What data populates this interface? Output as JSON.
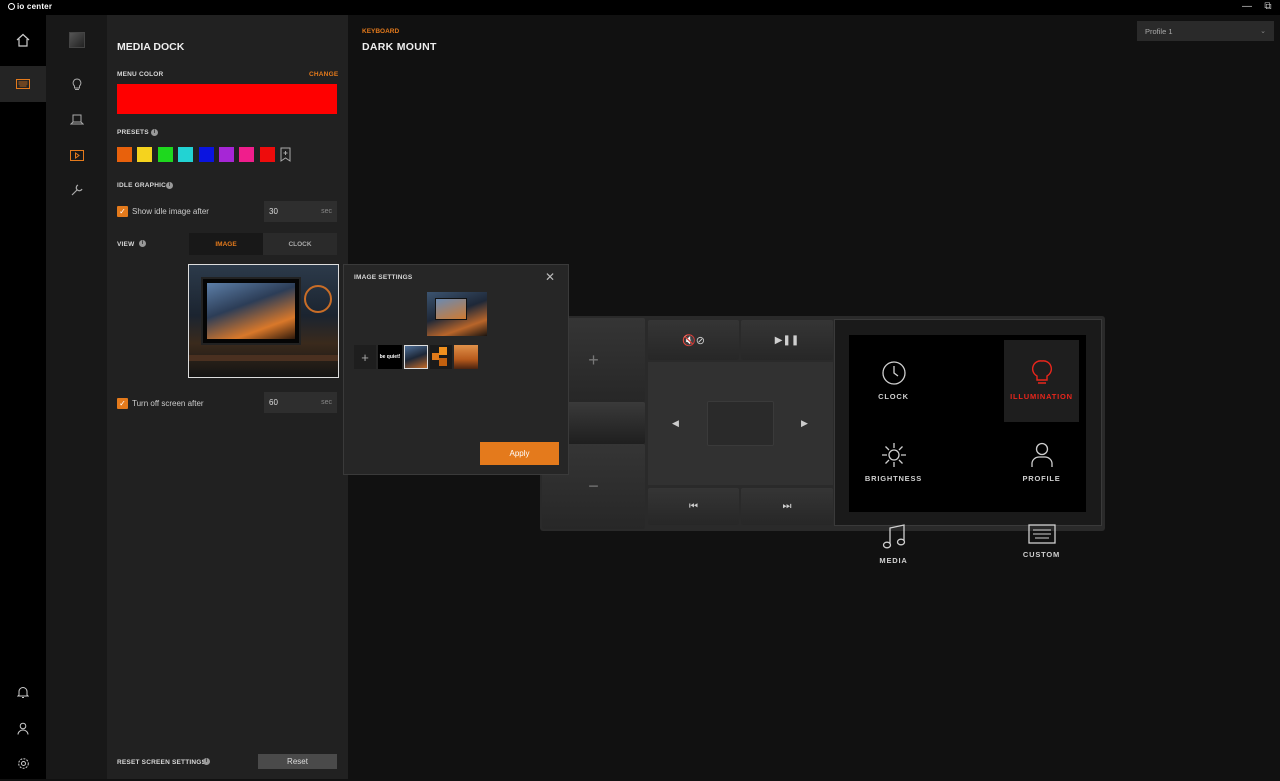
{
  "app": {
    "title": "io center"
  },
  "header": {
    "category": "KEYBOARD",
    "device": "DARK MOUNT",
    "profile": "Profile 1"
  },
  "panel": {
    "title": "MEDIA DOCK",
    "menu_color_label": "MENU COLOR",
    "change_label": "CHANGE",
    "menu_color": "#ff0000",
    "presets_label": "PRESETS",
    "presets": [
      "#e8610c",
      "#f5d31e",
      "#1ed81e",
      "#22d3d3",
      "#0a14e0",
      "#a626d6",
      "#f01e8c",
      "#ee0c0c"
    ],
    "idle_label": "IDLE GRAPHIC",
    "idle_check_label": "Show idle image after",
    "idle_value": "30",
    "idle_unit": "sec",
    "view_label": "VIEW",
    "view_tabs": [
      "IMAGE",
      "CLOCK"
    ],
    "turnoff_label": "Turn off screen after",
    "turnoff_value": "60",
    "turnoff_unit": "sec",
    "reset_label": "RESET SCREEN SETTINGS",
    "reset_button": "Reset"
  },
  "modal": {
    "title": "IMAGE SETTINGS",
    "thumb_text": "be quiet!",
    "apply": "Apply"
  },
  "screen": {
    "tiles": [
      "CLOCK",
      "ILLUMINATION",
      "BRIGHTNESS",
      "PROFILE",
      "MEDIA",
      "CUSTOM"
    ]
  },
  "colors": {
    "accent": "#e47a1c",
    "active_tile": "#e8261c"
  }
}
